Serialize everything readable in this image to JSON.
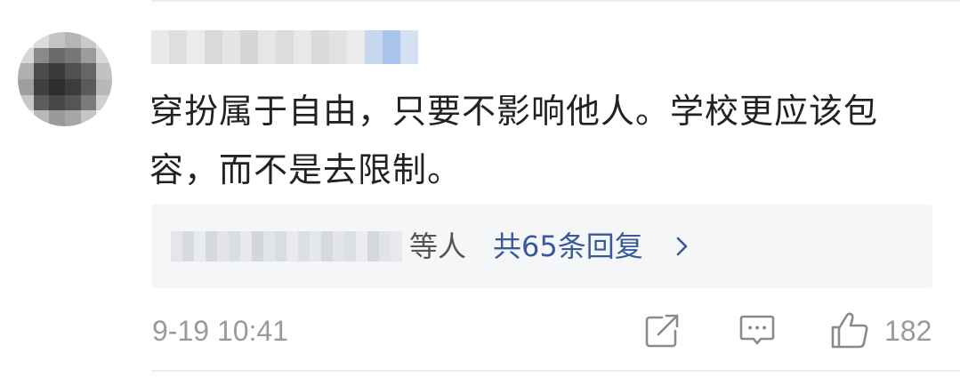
{
  "comment": {
    "text": "穿扮属于自由，只要不影响他人。学校更应该包容，而不是去限制。",
    "timestamp": "9-19 10:41",
    "like_count": "182"
  },
  "replies": {
    "suffix": "等人",
    "count_text": "共65条回复"
  },
  "icons": {
    "share": "share-icon",
    "reply": "comment-icon",
    "like": "thumbs-up-icon",
    "chevron": "chevron-right-icon"
  },
  "colors": {
    "text_primary": "#222222",
    "text_secondary": "#9a9a9a",
    "link_blue": "#3a5a97",
    "reply_bg": "#f5f6f8"
  }
}
